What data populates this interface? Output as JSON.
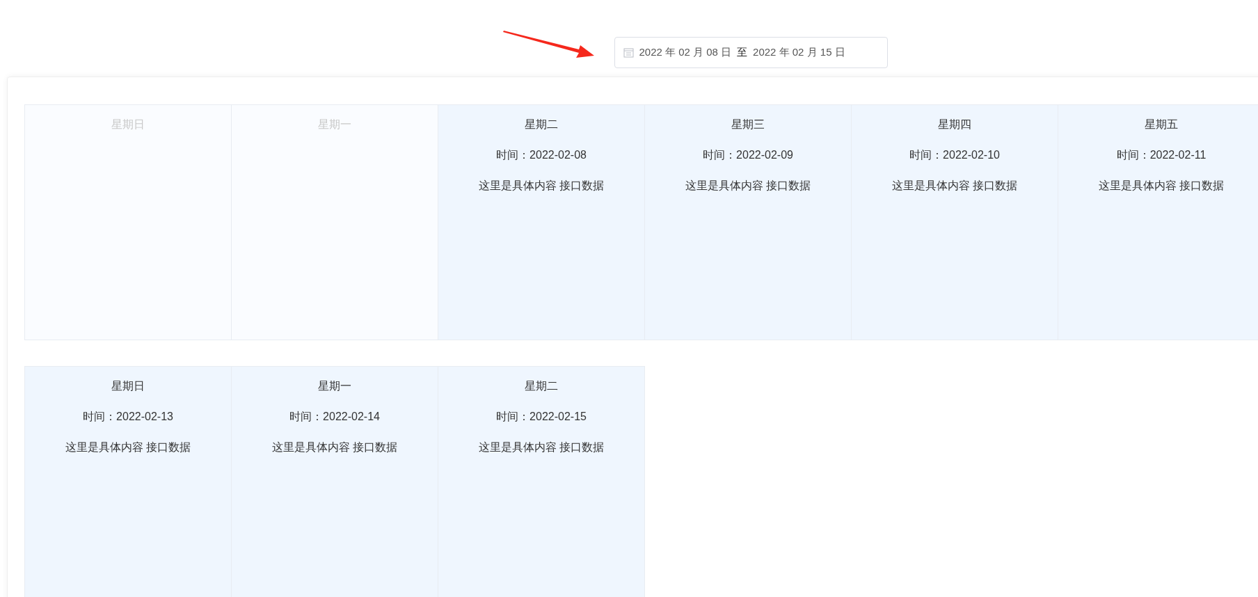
{
  "date_range": {
    "start": "2022 年 02 月 08 日",
    "separator": "至",
    "end": "2022 年 02 月 15 日"
  },
  "weeks": [
    [
      {
        "weekday": "星期日",
        "disabled": true
      },
      {
        "weekday": "星期一",
        "disabled": true
      },
      {
        "weekday": "星期二",
        "disabled": false,
        "time": "时间：2022-02-08",
        "content": "这里是具体内容 接口数据"
      },
      {
        "weekday": "星期三",
        "disabled": false,
        "time": "时间：2022-02-09",
        "content": "这里是具体内容 接口数据"
      },
      {
        "weekday": "星期四",
        "disabled": false,
        "time": "时间：2022-02-10",
        "content": "这里是具体内容 接口数据"
      },
      {
        "weekday": "星期五",
        "disabled": false,
        "time": "时间：2022-02-11",
        "content": "这里是具体内容 接口数据"
      }
    ],
    [
      {
        "weekday": "星期日",
        "disabled": false,
        "time": "时间：2022-02-13",
        "content": "这里是具体内容 接口数据"
      },
      {
        "weekday": "星期一",
        "disabled": false,
        "time": "时间：2022-02-14",
        "content": "这里是具体内容 接口数据"
      },
      {
        "weekday": "星期二",
        "disabled": false,
        "time": "时间：2022-02-15",
        "content": "这里是具体内容 接口数据"
      }
    ]
  ]
}
